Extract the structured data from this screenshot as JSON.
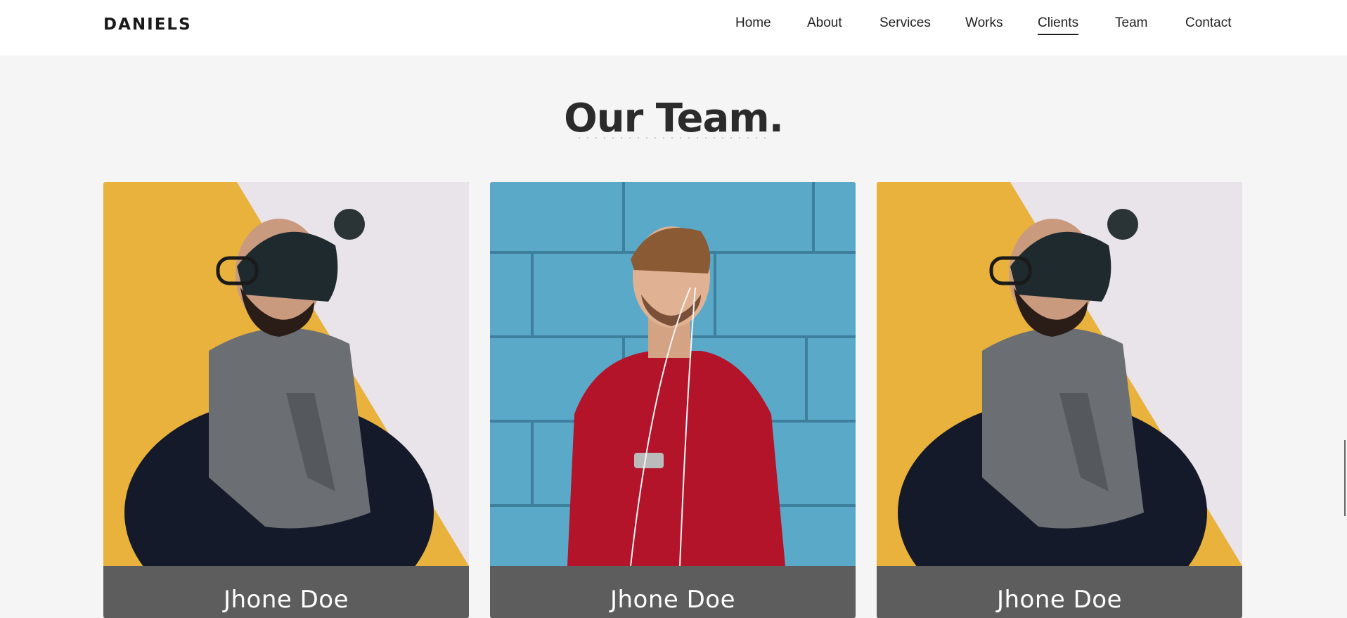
{
  "brand": {
    "logo": "DANIELS"
  },
  "nav": {
    "items": [
      "Home",
      "About",
      "Services",
      "Works",
      "Clients",
      "Team",
      "Contact"
    ],
    "active": "Clients"
  },
  "section": {
    "title": "Our Team."
  },
  "team": {
    "members": [
      {
        "name": "Jhone Doe",
        "photo": "man-with-beanie-and-scarf"
      },
      {
        "name": "Jhone Doe",
        "photo": "man-in-red-sweater-with-earphones"
      },
      {
        "name": "Jhone Doe",
        "photo": "man-with-beanie-and-scarf"
      }
    ]
  },
  "colors": {
    "background": "#f5f5f5",
    "header": "#ffffff",
    "name_bar": "#5d5d5d",
    "yellow_wall": "#e8b23d",
    "blue_wall": "#5aa9c9",
    "red_sweater": "#b3142a"
  }
}
